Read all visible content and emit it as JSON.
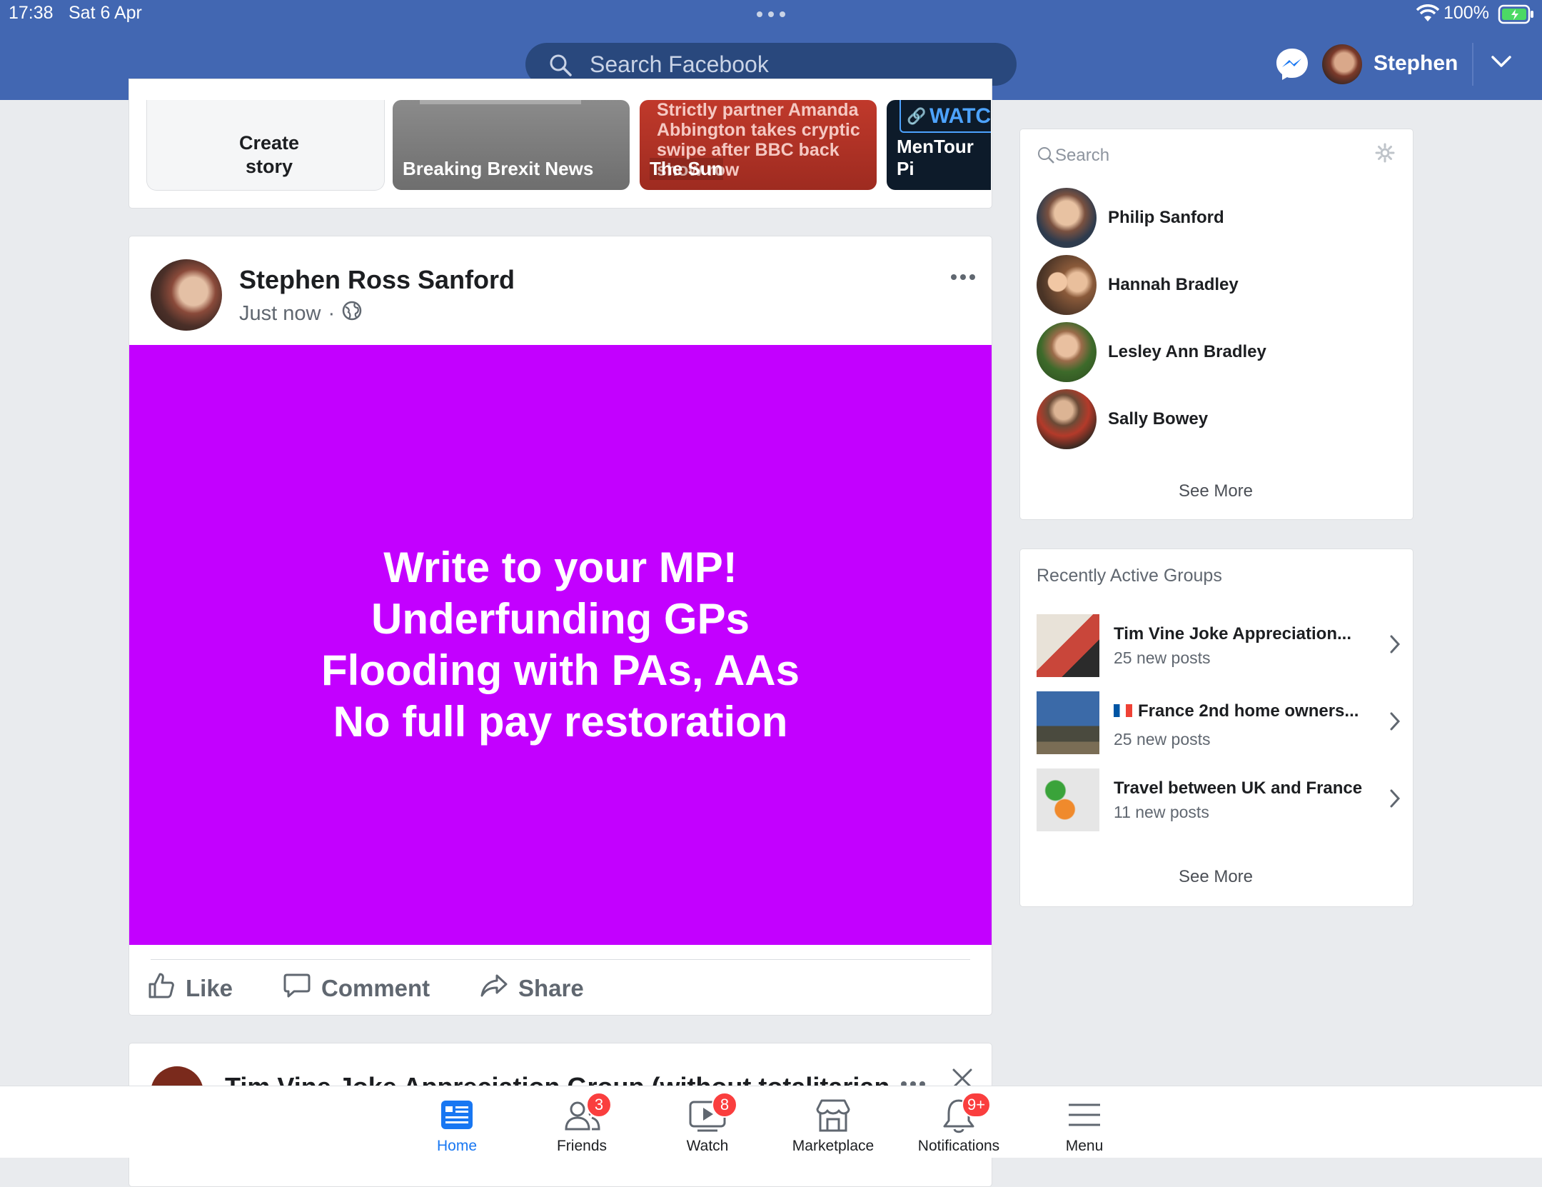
{
  "status_bar": {
    "time": "17:38",
    "date": "Sat 6 Apr",
    "battery": "100%"
  },
  "header": {
    "search_placeholder": "Search Facebook",
    "user_name": "Stephen",
    "colors": {
      "bar": "#4267b2",
      "search": "#29487d"
    }
  },
  "stories": [
    {
      "label": "Create story"
    },
    {
      "label": "Breaking Brexit News"
    },
    {
      "label": "The Sun",
      "headline": "Strictly partner Amanda Abbington takes cryptic swipe after BBC back show row"
    },
    {
      "label": "MenTour Pi",
      "badge": "WATCH"
    }
  ],
  "post": {
    "author": "Stephen Ross Sanford",
    "time": "Just now",
    "privacy_icon": "globe-icon",
    "background_color": "#c300ff",
    "text_lines": [
      "Write to your MP!",
      "Underfunding GPs",
      "Flooding with PAs, AAs",
      "No full pay restoration"
    ],
    "actions": {
      "like": "Like",
      "comment": "Comment",
      "share": "Share"
    }
  },
  "next_post": {
    "title": "Tim Vine Joke Appreciation Group (without totalitarian"
  },
  "contacts": {
    "search_placeholder": "Search",
    "items": [
      {
        "name": "Philip Sanford"
      },
      {
        "name": "Hannah Bradley"
      },
      {
        "name": "Lesley Ann Bradley"
      },
      {
        "name": "Sally Bowey"
      }
    ],
    "see_more": "See More"
  },
  "groups": {
    "title": "Recently Active Groups",
    "items": [
      {
        "name": "Tim Vine Joke Appreciation...",
        "count": "25 new posts"
      },
      {
        "name": "France 2nd home owners...",
        "count": "25 new posts"
      },
      {
        "name": "Travel between UK and France",
        "count": "11 new posts"
      }
    ],
    "see_more": "See More"
  },
  "tabs": [
    {
      "label": "Home",
      "active": true
    },
    {
      "label": "Friends",
      "badge": "3"
    },
    {
      "label": "Watch",
      "badge": "8"
    },
    {
      "label": "Marketplace"
    },
    {
      "label": "Notifications",
      "badge": "9+"
    },
    {
      "label": "Menu"
    }
  ]
}
